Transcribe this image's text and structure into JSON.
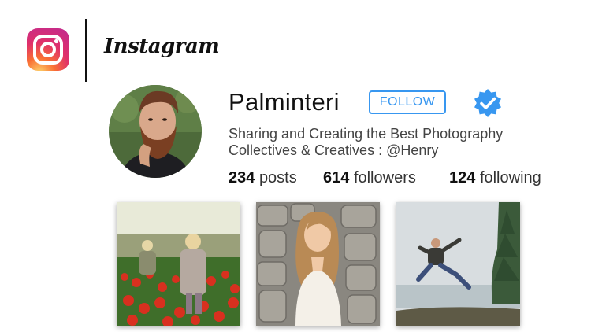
{
  "brand": {
    "wordmark": "Instagram",
    "logo_icon": "instagram-logo-icon",
    "gradient": [
      "#feda75",
      "#fa7e1e",
      "#d62976",
      "#962fbf",
      "#4f5bd5"
    ]
  },
  "profile": {
    "username": "Palminteri",
    "follow_label": "FOLLOW",
    "verified_icon": "verified-badge-icon",
    "bio_line1": "Sharing and Creating the Best Photography",
    "bio_line2": "Collectives & Creatives : @Henry",
    "accent": "#3897f0"
  },
  "stats": [
    {
      "count": "234",
      "label": "posts"
    },
    {
      "count": "614",
      "label": "followers"
    },
    {
      "count": "124",
      "label": "following"
    }
  ]
}
